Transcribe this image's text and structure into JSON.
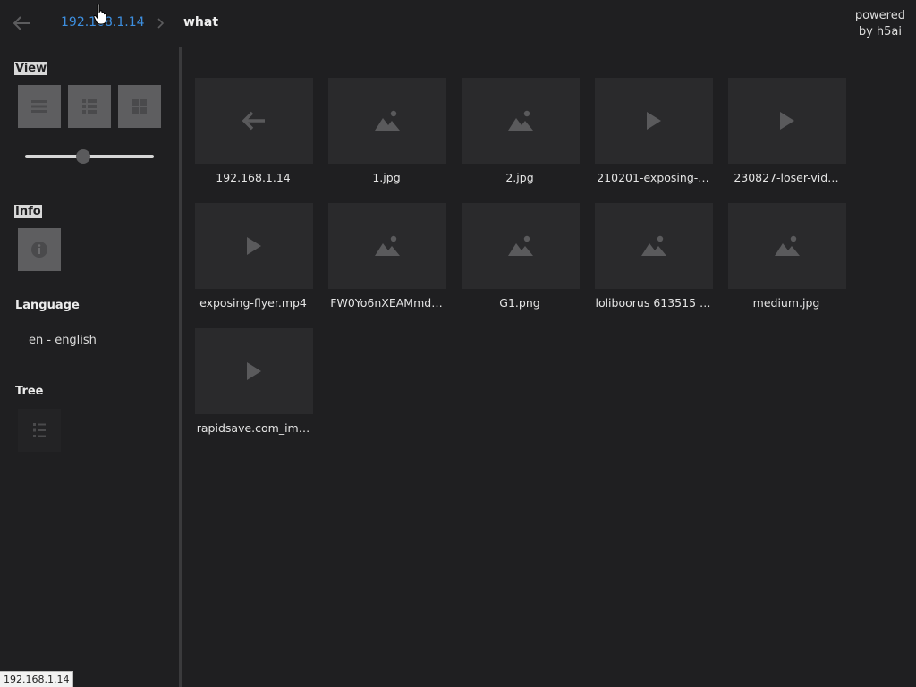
{
  "header": {
    "breadcrumb": [
      {
        "label": "192.168.1.14"
      },
      {
        "label": "what"
      }
    ],
    "powered_line1": "powered",
    "powered_line2": "by h5ai"
  },
  "sidebar": {
    "view": {
      "title": "View",
      "modes": [
        "details",
        "grid",
        "icons"
      ],
      "size_slider_value": 0.45
    },
    "info": {
      "title": "Info"
    },
    "language": {
      "title": "Language",
      "value": "en - english"
    },
    "tree": {
      "title": "Tree"
    }
  },
  "items": [
    {
      "name": "192.168.1.14",
      "icon": "parent-folder-icon"
    },
    {
      "name": "1.jpg",
      "icon": "image-icon"
    },
    {
      "name": "2.jpg",
      "icon": "image-icon"
    },
    {
      "name": "210201-exposing-…",
      "icon": "video-icon"
    },
    {
      "name": "230827-loser-vid…",
      "icon": "video-icon"
    },
    {
      "name": "exposing-flyer.mp4",
      "icon": "video-icon"
    },
    {
      "name": "FW0Yo6nXEAMmd…",
      "icon": "image-icon"
    },
    {
      "name": "G1.png",
      "icon": "image-icon"
    },
    {
      "name": "loliboorus 613515 …",
      "icon": "image-icon"
    },
    {
      "name": "medium.jpg",
      "icon": "image-icon"
    },
    {
      "name": "rapidsave.com_im…",
      "icon": "video-icon"
    }
  ],
  "status_bar": {
    "text": "192.168.1.14"
  },
  "colors": {
    "background": "#1f1f21",
    "link": "#3d8fe0",
    "thumb": "#2a2a2c",
    "icon": "#5a5a5c"
  }
}
